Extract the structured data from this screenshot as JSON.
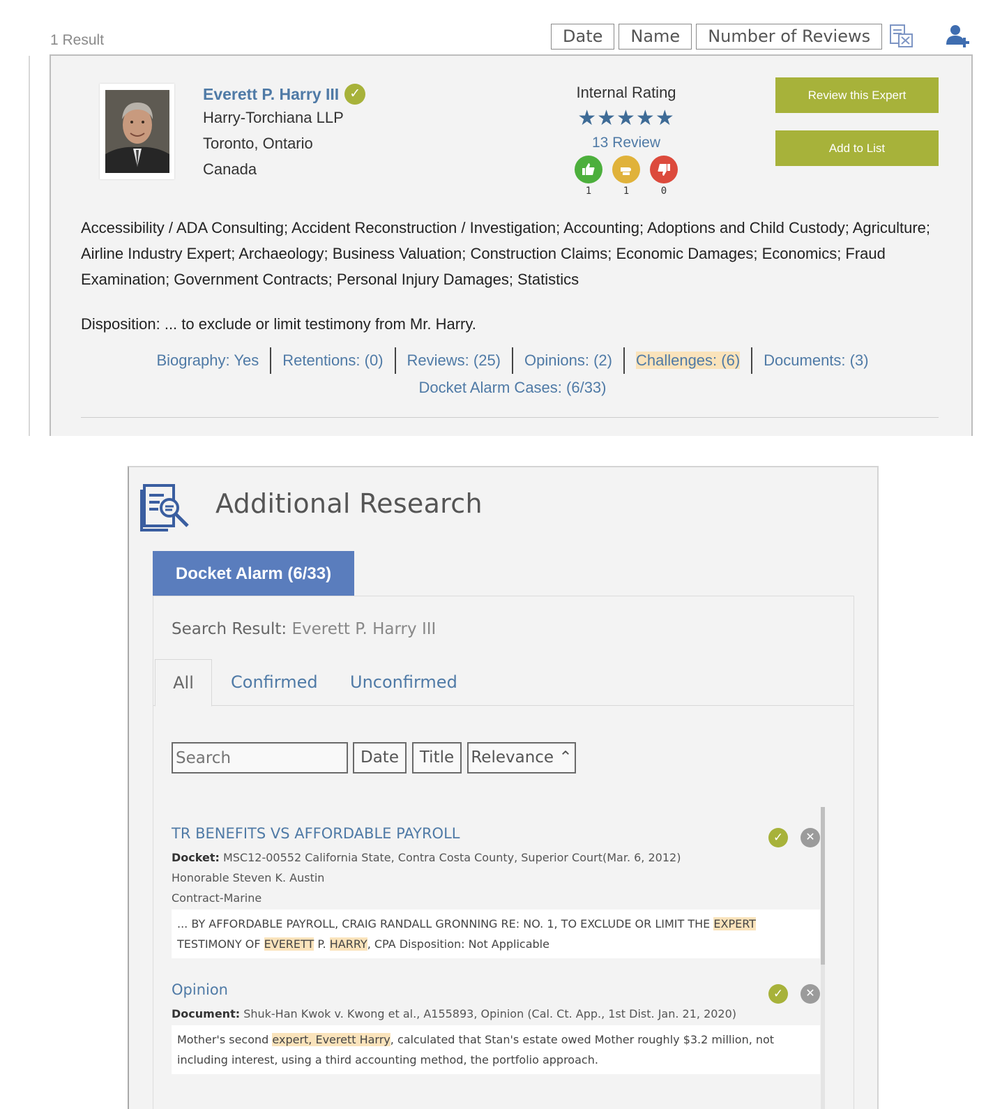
{
  "results": {
    "count_label": "1 Result"
  },
  "sort": {
    "date": "Date",
    "name": "Name",
    "reviews": "Number of Reviews"
  },
  "expert": {
    "name": "Everett P. Harry III",
    "firm": "Harry-Torchiana LLP",
    "city": "Toronto, Ontario",
    "country": "Canada",
    "rating_title": "Internal Rating",
    "stars": "★★★★★",
    "review_count": "13 Review",
    "votes": {
      "up": "1",
      "neutral": "1",
      "down": "0"
    },
    "review_button": "Review this Expert",
    "add_button": "Add to List",
    "categories": "Accessibility / ADA Consulting; Accident Reconstruction / Investigation; Accounting; Adoptions and Child Custody; Agriculture; Airline Industry Expert; Archaeology; Business Valuation; Construction Claims; Economic Damages; Economics; Fraud Examination; Government Contracts; Personal Injury Damages; Statistics",
    "disposition": "Disposition: ... to exclude or limit testimony from Mr. Harry.",
    "links": [
      "Biography: Yes",
      "Retentions: (0)",
      "Reviews: (25)",
      "Opinions: (2)",
      "Challenges: (6)",
      "Documents: (3)"
    ],
    "docket_link": "Docket Alarm Cases: (6/33)"
  },
  "research": {
    "title": "Additional Research",
    "tab": "Docket Alarm (6/33)",
    "search_result_prefix": "Search Result:",
    "search_result_name": "Everett P. Harry III",
    "subtabs": {
      "all": "All",
      "confirmed": "Confirmed",
      "unconfirmed": "Unconfirmed"
    },
    "search_placeholder": "Search",
    "tools": {
      "date": "Date",
      "title": "Title",
      "relevance": "Relevance ⌃"
    },
    "cases": [
      {
        "title": "TR BENEFITS VS AFFORDABLE PAYROLL",
        "docket_label": "Docket:",
        "docket": "MSC12-00552 California State, Contra Costa County, Superior Court(Mar. 6, 2012)",
        "judge": "Honorable Steven K. Austin",
        "type": "Contract-Marine",
        "snippet_a": "... BY AFFORDABLE PAYROLL, CRAIG RANDALL GRONNING RE: NO. 1, TO EXCLUDE OR LIMIT THE ",
        "snippet_hl1": "EXPERT",
        "snippet_b": " TESTIMONY OF ",
        "snippet_hl2": "EVERETT",
        "snippet_c": " P. ",
        "snippet_hl3": "HARRY",
        "snippet_d": ", CPA Disposition: Not Applicable"
      },
      {
        "title": "Opinion",
        "doc_label": "Document:",
        "document": "Shuk-Han Kwok v. Kwong et al., A155893, Opinion (Cal. Ct. App., 1st Dist. Jan. 21, 2020)",
        "snippet_a": "Mother's second ",
        "snippet_hl1": "expert, Everett Harry",
        "snippet_b": ", calculated that Stan's estate owed Mother roughly $3.2 million, not including interest, using a third accounting method, the portfolio approach."
      }
    ]
  }
}
